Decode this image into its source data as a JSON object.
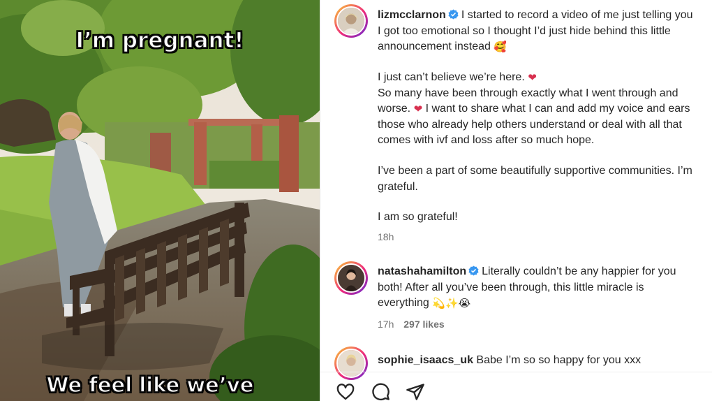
{
  "photo": {
    "caption_top": "I’m pregnant!",
    "caption_bottom": "We feel like we’ve"
  },
  "post": {
    "author": "lizmcclarnon",
    "lines": [
      "I started to record a video of me just telling you",
      "I got too emotional so I thought I’d just hide behind this little",
      "announcement instead",
      "I just can’t believe we’re here.",
      "So many have been through exactly what I went through and",
      "worse.",
      "I want to share what I can and add my voice and ears",
      "those who already help others understand or deal with all that",
      "comes with ivf and loss after so much hope.",
      "I’ve been a part of some beautifully supportive communities. I’m",
      "grateful.",
      "I am so grateful!"
    ],
    "time": "18h"
  },
  "comments": [
    {
      "author": "natashahamilton",
      "lines": [
        "Literally couldn’t be any happier for you",
        "both! After all you’ve been through, this little miracle is",
        "everything"
      ],
      "time": "17h",
      "likes": "297 likes"
    },
    {
      "author": "sophie_isaacs_uk",
      "text": "Babe I’m so so happy for you xxx"
    }
  ],
  "icons": [
    "verified-badge-icon",
    "heart-icon",
    "comment-icon",
    "share-icon",
    "red-heart-emoji",
    "smiling-hearts-emoji",
    "dizzy-emoji",
    "sparkles-emoji",
    "crying-face-emoji"
  ],
  "colors": {
    "verified": "#3897f0",
    "ring_start": "#f9ce34",
    "ring_mid": "#ee2a7b",
    "ring_end": "#6228d7",
    "text": "#262626",
    "meta": "#737373"
  }
}
